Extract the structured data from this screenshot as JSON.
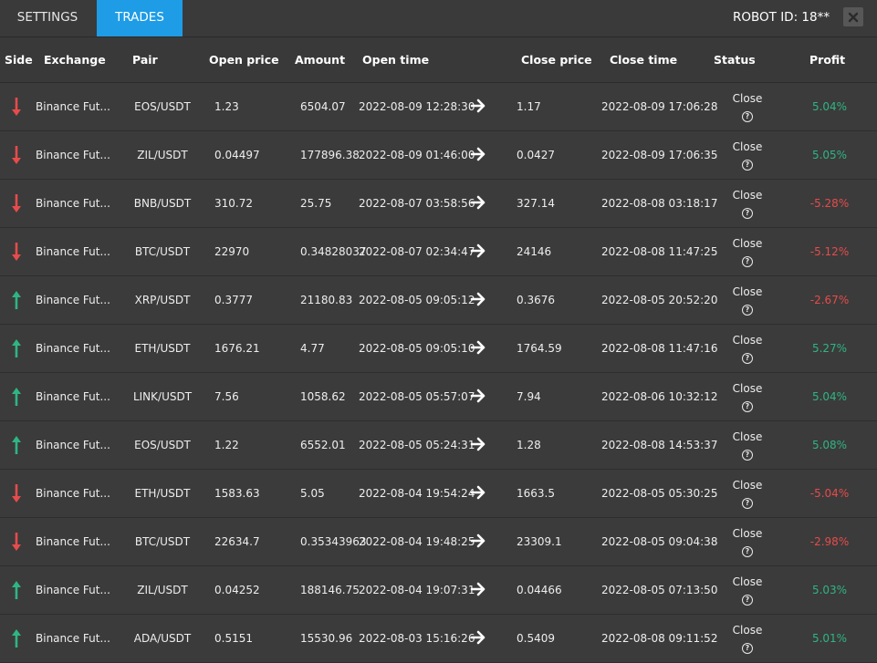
{
  "tabs": {
    "settings": "SETTINGS",
    "trades": "TRADES"
  },
  "robot_id": "ROBOT ID: 18**",
  "colors": {
    "accent": "#1e9ce6",
    "up": "#2fb583",
    "down": "#e74b4b"
  },
  "columns": [
    "Side",
    "Exchange",
    "Pair",
    "Open price",
    "Amount",
    "Open time",
    "Close price",
    "Close time",
    "Status",
    "Profit"
  ],
  "trades": [
    {
      "side": "down",
      "exchange": "Binance Fut...",
      "pair": "EOS/USDT",
      "open_price": "1.23",
      "amount": "6504.07",
      "open_time": "2022-08-09 12:28:30",
      "close_price": "1.17",
      "close_time": "2022-08-09 17:06:28",
      "status": "Close",
      "profit": "5.04%"
    },
    {
      "side": "down",
      "exchange": "Binance Fut...",
      "pair": "ZIL/USDT",
      "open_price": "0.04497",
      "amount": "177896.38",
      "open_time": "2022-08-09 01:46:00",
      "close_price": "0.0427",
      "close_time": "2022-08-09 17:06:35",
      "status": "Close",
      "profit": "5.05%"
    },
    {
      "side": "down",
      "exchange": "Binance Fut...",
      "pair": "BNB/USDT",
      "open_price": "310.72",
      "amount": "25.75",
      "open_time": "2022-08-07 03:58:56",
      "close_price": "327.14",
      "close_time": "2022-08-08 03:18:17",
      "status": "Close",
      "profit": "-5.28%"
    },
    {
      "side": "down",
      "exchange": "Binance Fut...",
      "pair": "BTC/USDT",
      "open_price": "22970",
      "amount": "0.34828037",
      "open_time": "2022-08-07 02:34:47",
      "close_price": "24146",
      "close_time": "2022-08-08 11:47:25",
      "status": "Close",
      "profit": "-5.12%"
    },
    {
      "side": "up",
      "exchange": "Binance Fut...",
      "pair": "XRP/USDT",
      "open_price": "0.3777",
      "amount": "21180.83",
      "open_time": "2022-08-05 09:05:12",
      "close_price": "0.3676",
      "close_time": "2022-08-05 20:52:20",
      "status": "Close",
      "profit": "-2.67%"
    },
    {
      "side": "up",
      "exchange": "Binance Fut...",
      "pair": "ETH/USDT",
      "open_price": "1676.21",
      "amount": "4.77",
      "open_time": "2022-08-05 09:05:10",
      "close_price": "1764.59",
      "close_time": "2022-08-08 11:47:16",
      "status": "Close",
      "profit": "5.27%"
    },
    {
      "side": "up",
      "exchange": "Binance Fut...",
      "pair": "LINK/USDT",
      "open_price": "7.56",
      "amount": "1058.62",
      "open_time": "2022-08-05 05:57:07",
      "close_price": "7.94",
      "close_time": "2022-08-06 10:32:12",
      "status": "Close",
      "profit": "5.04%"
    },
    {
      "side": "up",
      "exchange": "Binance Fut...",
      "pair": "EOS/USDT",
      "open_price": "1.22",
      "amount": "6552.01",
      "open_time": "2022-08-05 05:24:31",
      "close_price": "1.28",
      "close_time": "2022-08-08 14:53:37",
      "status": "Close",
      "profit": "5.08%"
    },
    {
      "side": "down",
      "exchange": "Binance Fut...",
      "pair": "ETH/USDT",
      "open_price": "1583.63",
      "amount": "5.05",
      "open_time": "2022-08-04 19:54:24",
      "close_price": "1663.5",
      "close_time": "2022-08-05 05:30:25",
      "status": "Close",
      "profit": "-5.04%"
    },
    {
      "side": "down",
      "exchange": "Binance Fut...",
      "pair": "BTC/USDT",
      "open_price": "22634.7",
      "amount": "0.35343963",
      "open_time": "2022-08-04 19:48:25",
      "close_price": "23309.1",
      "close_time": "2022-08-05 09:04:38",
      "status": "Close",
      "profit": "-2.98%"
    },
    {
      "side": "up",
      "exchange": "Binance Fut...",
      "pair": "ZIL/USDT",
      "open_price": "0.04252",
      "amount": "188146.75",
      "open_time": "2022-08-04 19:07:31",
      "close_price": "0.04466",
      "close_time": "2022-08-05 07:13:50",
      "status": "Close",
      "profit": "5.03%"
    },
    {
      "side": "up",
      "exchange": "Binance Fut...",
      "pair": "ADA/USDT",
      "open_price": "0.5151",
      "amount": "15530.96",
      "open_time": "2022-08-03 15:16:26",
      "close_price": "0.5409",
      "close_time": "2022-08-08 09:11:52",
      "status": "Close",
      "profit": "5.01%"
    }
  ]
}
